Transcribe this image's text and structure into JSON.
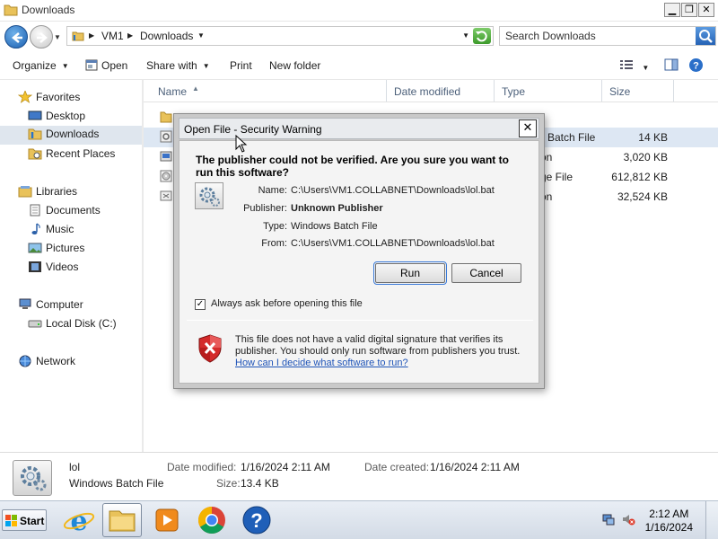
{
  "window": {
    "title": "Downloads",
    "controls": {
      "minimize": "▁",
      "maximize": "❐",
      "close": "✕"
    }
  },
  "address": {
    "crumbs": [
      "VM1",
      "Downloads"
    ]
  },
  "search": {
    "placeholder": "Search Downloads"
  },
  "toolbar": {
    "organize": "Organize",
    "open": "Open",
    "share_with": "Share with",
    "print": "Print",
    "new_folder": "New folder"
  },
  "sidebar": {
    "favorites": {
      "label": "Favorites",
      "items": [
        "Desktop",
        "Downloads",
        "Recent Places"
      ]
    },
    "libraries": {
      "label": "Libraries",
      "items": [
        "Documents",
        "Music",
        "Pictures",
        "Videos"
      ]
    },
    "computer": {
      "label": "Computer",
      "items": [
        "Local Disk (C:)"
      ]
    },
    "network": {
      "label": "Network"
    },
    "selected": "Downloads"
  },
  "columns": {
    "name": "Name",
    "date_modified": "Date modified",
    "type": "Type",
    "size": "Size"
  },
  "files": [
    {
      "type_visible": "r",
      "size": ""
    },
    {
      "type_visible": "Batch File",
      "size": "14 KB"
    },
    {
      "type_visible": "on",
      "size": "3,020 KB"
    },
    {
      "type_visible": "ge File",
      "size": "612,812 KB"
    },
    {
      "type_visible": "on",
      "size": "32,524 KB"
    }
  ],
  "details": {
    "name": "lol",
    "type": "Windows Batch File",
    "date_modified_label": "Date modified:",
    "date_modified": "1/16/2024 2:11 AM",
    "date_created_label": "Date created:",
    "date_created": "1/16/2024 2:11 AM",
    "size_label": "Size:",
    "size": "13.4 KB"
  },
  "dialog": {
    "title": "Open File - Security Warning",
    "close": "✕",
    "headline": "The publisher could not be verified.  Are you sure you want to run this software?",
    "labels": {
      "name": "Name:",
      "publisher": "Publisher:",
      "type": "Type:",
      "from": "From:"
    },
    "values": {
      "name": "C:\\Users\\VM1.COLLABNET\\Downloads\\lol.bat",
      "publisher": "Unknown Publisher",
      "type": "Windows Batch File",
      "from": "C:\\Users\\VM1.COLLABNET\\Downloads\\lol.bat"
    },
    "run_button": "Run",
    "cancel_button": "Cancel",
    "checkbox_label": "Always ask before opening this file",
    "checkbox_checked": true,
    "checkbox_mark": "✓",
    "warning_text": "This file does not have a valid digital signature that verifies its publisher.  You should only run software from publishers you trust.",
    "warning_link": "How can I decide what software to run?"
  },
  "taskbar": {
    "start": "Start",
    "apps": [
      "internet-explorer",
      "windows-explorer",
      "media-player",
      "chrome",
      "help"
    ],
    "time": "2:12 AM",
    "date": "1/16/2024"
  }
}
